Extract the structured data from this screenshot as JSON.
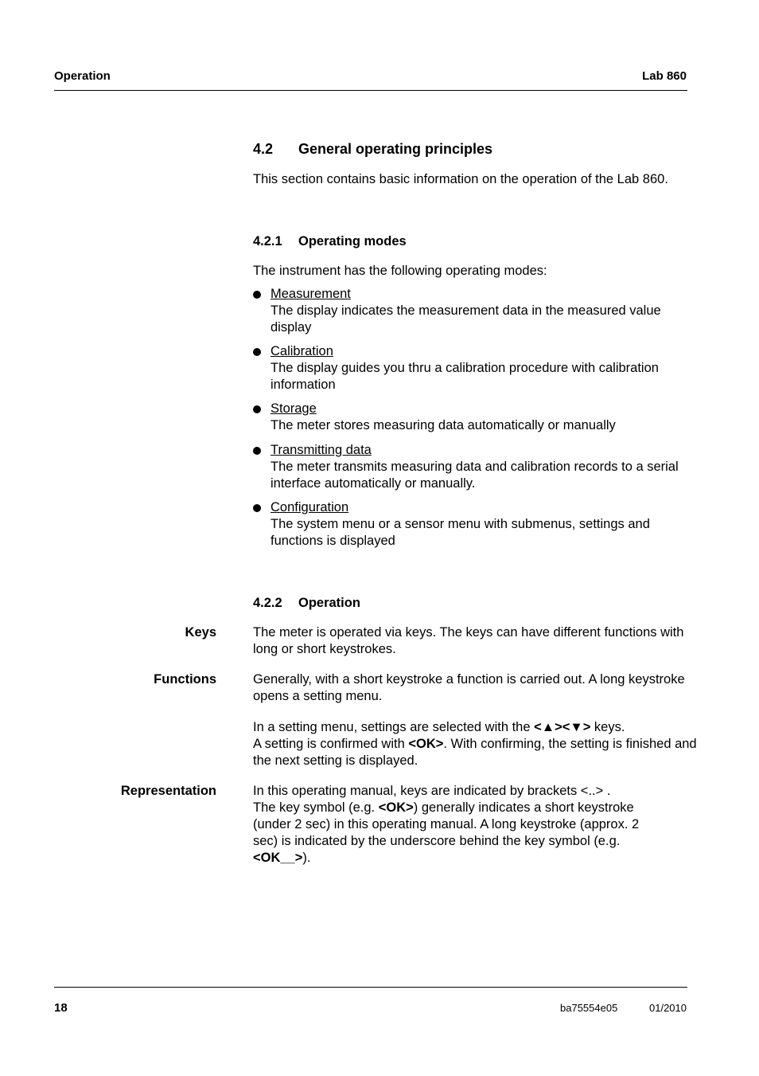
{
  "header": {
    "left": "Operation",
    "right": "Lab 860"
  },
  "section": {
    "number": "4.2",
    "title": "General operating principles",
    "intro": "This section contains basic information on the operation of the Lab 860."
  },
  "subsection1": {
    "number": "4.2.1",
    "title": "Operating modes",
    "intro": "The instrument has the following operating modes:",
    "items": [
      {
        "title": "Measurement",
        "text": "The display indicates the measurement data in the measured value display"
      },
      {
        "title": "Calibration",
        "text": "The display guides you thru a calibration procedure with calibration information"
      },
      {
        "title": "Storage",
        "text": "The meter stores measuring data automatically or manually"
      },
      {
        "title": "Transmitting data",
        "text": "The meter transmits measuring data and calibration records to a serial interface automatically or manually."
      },
      {
        "title": "Configuration",
        "text": "The system menu or a sensor menu with submenus, settings and functions is displayed"
      }
    ]
  },
  "subsection2": {
    "number": "4.2.2",
    "title": "Operation",
    "keys": {
      "label": "Keys",
      "text": "The meter is operated via keys. The keys can have different functions with long or short keystrokes."
    },
    "functions": {
      "label": "Functions",
      "text1": "Generally, with a short keystroke a function is carried out. A long keystroke opens a setting menu.",
      "text2_a": "In a setting menu, settings are selected with the ",
      "text2_keys": "<▲><▼>",
      "text2_b": " keys.",
      "text2_c": "A setting is confirmed with ",
      "text2_ok": "<OK>",
      "text2_d": ". With confirming, the setting is finished and the next setting is displayed."
    },
    "representation": {
      "label": "Representation",
      "text_a": "In this operating manual, keys are indicated by brackets <..> .",
      "text_b": "The key symbol (e.g. ",
      "text_ok": "<OK>",
      "text_c": ") generally indicates a short keystroke (under 2 sec) in this operating manual. A long keystroke (approx. 2 sec) is indicated by the underscore behind the key symbol (e.g. ",
      "text_ok_long": "<OK__>",
      "text_d": ")."
    }
  },
  "footer": {
    "page": "18",
    "doc_id": "ba75554e05",
    "date": "01/2010"
  }
}
